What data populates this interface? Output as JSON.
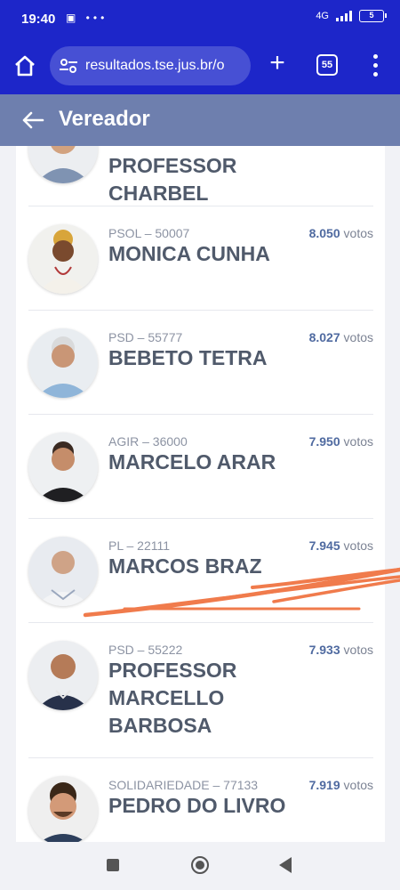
{
  "status": {
    "time": "19:40",
    "network": "4G",
    "battery": "5"
  },
  "browser": {
    "url": "resultados.tse.jus.br/o",
    "tab_count": "55"
  },
  "header": {
    "title": "Vereador"
  },
  "candidates": [
    {
      "party": "",
      "votes": "",
      "votes_suffix": "",
      "name_lines": [
        "PROFESSOR",
        "CHARBEL"
      ]
    },
    {
      "party": "PSOL – 50007",
      "votes": "8.050",
      "votes_suffix": " votos",
      "name_lines": [
        "MONICA CUNHA"
      ]
    },
    {
      "party": "PSD – 55777",
      "votes": "8.027",
      "votes_suffix": " votos",
      "name_lines": [
        "BEBETO TETRA"
      ]
    },
    {
      "party": "AGIR – 36000",
      "votes": "7.950",
      "votes_suffix": " votos",
      "name_lines": [
        "MARCELO ARAR"
      ]
    },
    {
      "party": "PL – 22111",
      "votes": "7.945",
      "votes_suffix": " votos",
      "name_lines": [
        "MARCOS BRAZ"
      ]
    },
    {
      "party": "PSD – 55222",
      "votes": "7.933",
      "votes_suffix": " votos",
      "name_lines": [
        "PROFESSOR",
        "MARCELLO",
        "BARBOSA"
      ]
    },
    {
      "party": "SOLIDARIEDADE – 77133",
      "votes": "7.919",
      "votes_suffix": " votos",
      "name_lines": [
        "PEDRO DO LIVRO"
      ]
    }
  ],
  "colors": {
    "browser_bar": "#1d26c9",
    "header": "#6e7fae",
    "vote_value": "#4f6aa0",
    "scribble": "#f07b4c"
  }
}
